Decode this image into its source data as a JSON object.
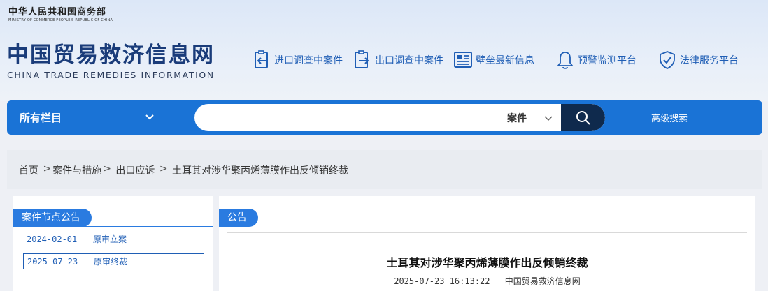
{
  "header": {
    "ministry_cn": "中华人民共和国商务部",
    "ministry_en": "MINISTRY OF COMMERCE PEOPLE'S REPUBLIC OF CHINA",
    "site_title_cn": "中国贸易救济信息网",
    "site_title_en": "CHINA TRADE REMEDIES INFORMATION"
  },
  "nav": [
    {
      "label": "进口调查中案件",
      "icon": "import-doc-icon"
    },
    {
      "label": "出口调查中案件",
      "icon": "export-doc-icon"
    },
    {
      "label": "壁垒最新信息",
      "icon": "newspaper-icon"
    },
    {
      "label": "预警监测平台",
      "icon": "bell-icon"
    },
    {
      "label": "法律服务平台",
      "icon": "shield-check-icon"
    }
  ],
  "search": {
    "category_label": "所有栏目",
    "input_value": "",
    "scope_label": "案件",
    "advanced_label": "高级搜索"
  },
  "breadcrumb": [
    "首页",
    "案件与措施",
    "出口应诉",
    "土耳其对涉华聚丙烯薄膜作出反倾销终裁"
  ],
  "left_panel": {
    "title": "案件节点公告",
    "nodes": [
      {
        "date": "2024-02-01",
        "label": "原审立案"
      },
      {
        "date": "2025-07-23",
        "label": "原审终裁"
      }
    ]
  },
  "right_panel": {
    "tab": "公告",
    "article_title": "土耳其对涉华聚丙烯薄膜作出反倾销终裁",
    "article_time": "2025-07-23 16:13:22",
    "article_source": "中国贸易救济信息网"
  },
  "colors": {
    "brand_blue": "#1a73d6",
    "dark_navy": "#0f2a4d",
    "link_blue": "#1f5eb5"
  }
}
